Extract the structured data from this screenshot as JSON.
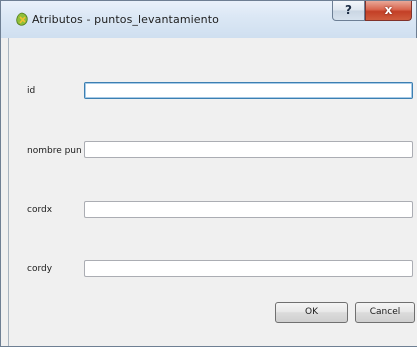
{
  "window": {
    "title": "Atributos - puntos_levantamiento",
    "icon": "qgis-icon",
    "help_glyph": "?",
    "close_glyph": "x"
  },
  "fields": [
    {
      "label": "id",
      "value": ""
    },
    {
      "label": "nombre pun",
      "value": ""
    },
    {
      "label": "cordx",
      "value": ""
    },
    {
      "label": "cordy",
      "value": ""
    }
  ],
  "buttons": {
    "ok_label": "OK",
    "cancel_label": "Cancel"
  },
  "colors": {
    "titlebar": "#dce8f5",
    "close_button": "#c33f26",
    "focus_border": "#3c7fb1"
  }
}
